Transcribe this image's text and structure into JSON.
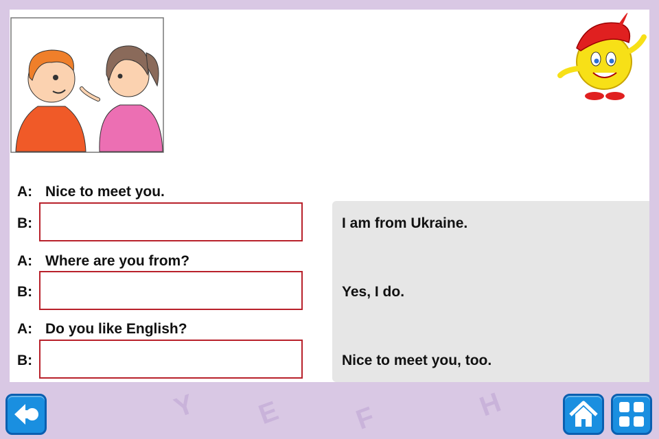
{
  "dialogue": [
    {
      "speaker": "A:",
      "text": "Nice to meet you."
    },
    {
      "speaker": "B:",
      "text": ""
    },
    {
      "speaker": "A:",
      "text": "Where are you from?"
    },
    {
      "speaker": "B:",
      "text": ""
    },
    {
      "speaker": "A:",
      "text": "Do you like English?"
    },
    {
      "speaker": "B:",
      "text": ""
    }
  ],
  "options": [
    "I am from Ukraine.",
    "Yes, I do.",
    "Nice to meet you, too."
  ],
  "background_letters": [
    "Y",
    "E",
    "F",
    "H"
  ],
  "nav": {
    "back": "back-arrow-icon",
    "home": "home-icon",
    "menu": "grid-menu-icon"
  },
  "colors": {
    "accent": "#1a8fe0",
    "answer_border": "#b8202a",
    "background": "#d9c8e4"
  }
}
